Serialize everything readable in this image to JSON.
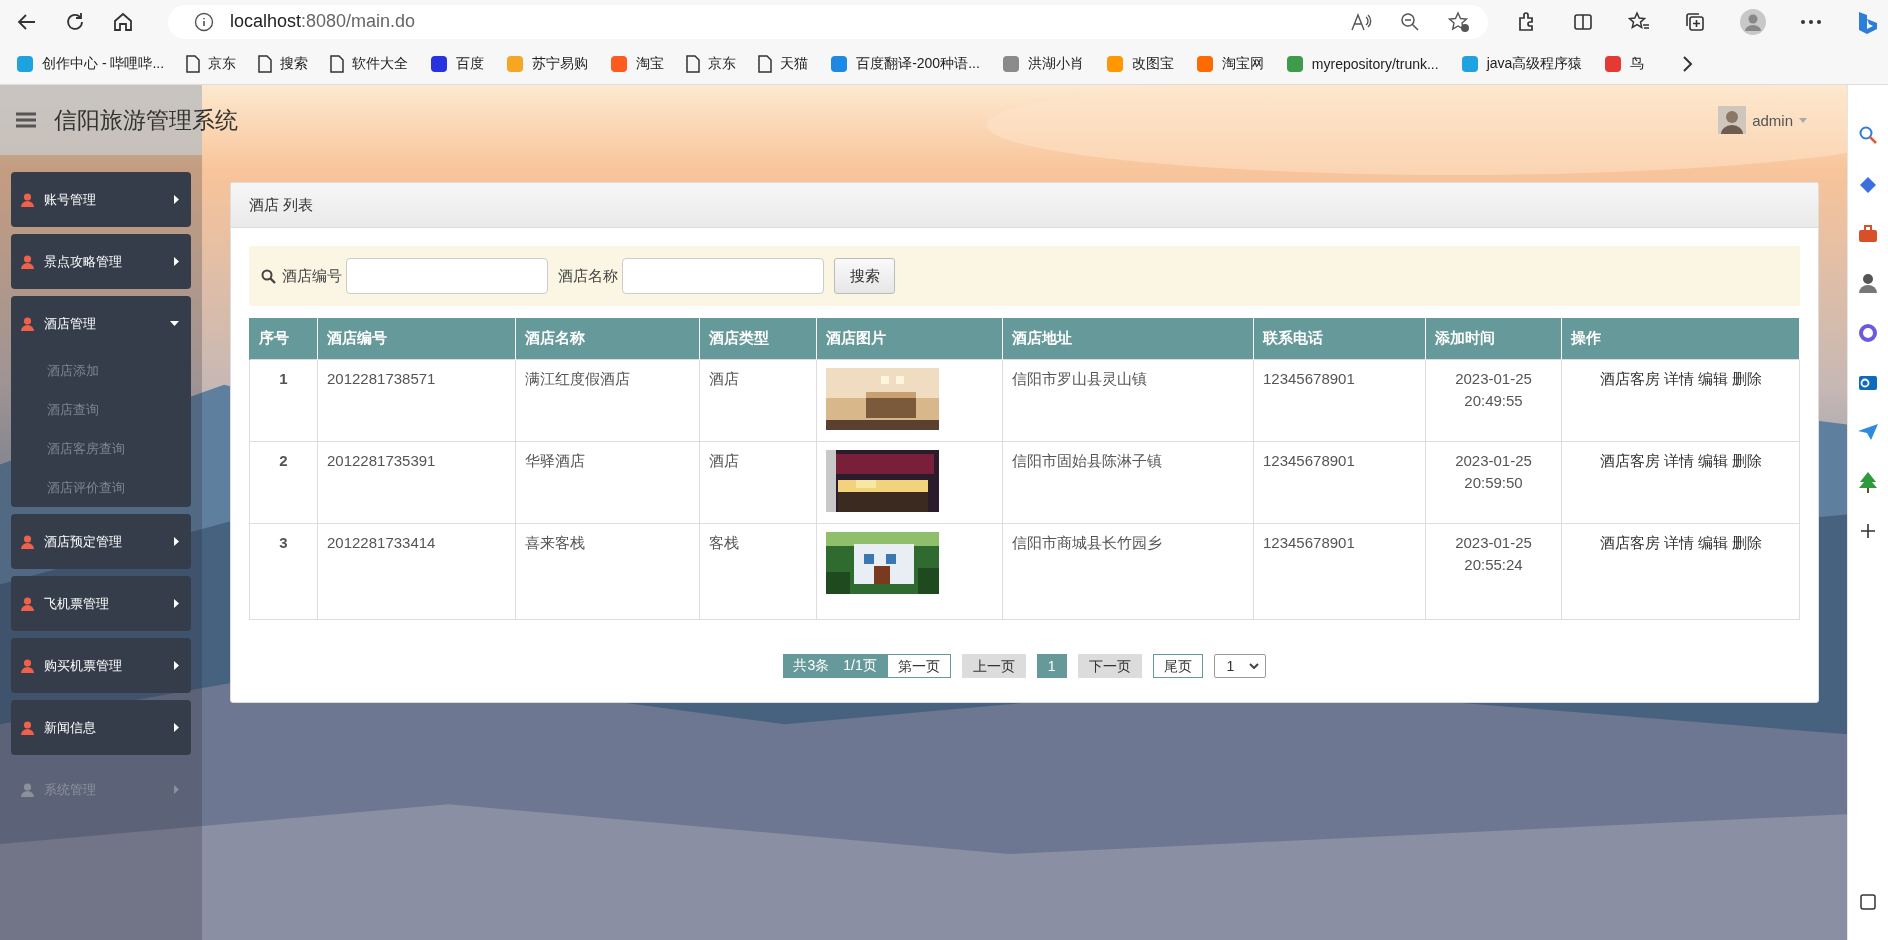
{
  "browser": {
    "address": {
      "host": "localhost",
      "path": ":8080/main.do"
    },
    "bookmarks": [
      {
        "label": "创作中心 - 哔哩哔...",
        "kind": "site",
        "color": "#1fa3e0"
      },
      {
        "label": "京东",
        "kind": "page"
      },
      {
        "label": "搜索",
        "kind": "page"
      },
      {
        "label": "软件大全",
        "kind": "page"
      },
      {
        "label": "百度",
        "kind": "site",
        "color": "#2932e1"
      },
      {
        "label": "苏宁易购",
        "kind": "site",
        "color": "#f5a623"
      },
      {
        "label": "淘宝",
        "kind": "site",
        "color": "#ff5a1f"
      },
      {
        "label": "京东",
        "kind": "page"
      },
      {
        "label": "天猫",
        "kind": "page"
      },
      {
        "label": "百度翻译-200种语...",
        "kind": "site",
        "color": "#1e88e5"
      },
      {
        "label": "洪湖小肖",
        "kind": "site",
        "color": "#8a8a8a"
      },
      {
        "label": "改图宝",
        "kind": "site",
        "color": "#ff9800"
      },
      {
        "label": "淘宝网",
        "kind": "site",
        "color": "#ff6a00"
      },
      {
        "label": "myrepository/trunk...",
        "kind": "site",
        "color": "#3f9a4a"
      },
      {
        "label": "java高级程序猿",
        "kind": "site",
        "color": "#1fa3e0"
      },
      {
        "label": "鸟",
        "kind": "site",
        "color": "#e53935"
      }
    ]
  },
  "header": {
    "title": "信阳旅游管理系统",
    "user": "admin"
  },
  "sidebar": {
    "items": [
      {
        "label": "账号管理",
        "expanded": false,
        "disabled": false
      },
      {
        "label": "景点攻略管理",
        "expanded": false,
        "disabled": false
      },
      {
        "label": "酒店管理",
        "expanded": true,
        "disabled": false,
        "children": [
          {
            "label": "酒店添加"
          },
          {
            "label": "酒店查询"
          },
          {
            "label": "酒店客房查询"
          },
          {
            "label": "酒店评价查询"
          }
        ]
      },
      {
        "label": "酒店预定管理",
        "expanded": false,
        "disabled": false
      },
      {
        "label": "飞机票管理",
        "expanded": false,
        "disabled": false
      },
      {
        "label": "购买机票管理",
        "expanded": false,
        "disabled": false
      },
      {
        "label": "新闻信息",
        "expanded": false,
        "disabled": false
      },
      {
        "label": "系统管理",
        "expanded": false,
        "disabled": true
      }
    ]
  },
  "panel": {
    "title": "酒店 列表",
    "search": {
      "fields": [
        {
          "label": "酒店编号"
        },
        {
          "label": "酒店名称"
        }
      ],
      "button": "搜索"
    },
    "table": {
      "columns": [
        "序号",
        "酒店编号",
        "酒店名称",
        "酒店类型",
        "酒店图片",
        "酒店地址",
        "联系电话",
        "添加时间",
        "操作"
      ],
      "rows": [
        {
          "no": "1",
          "code": "2012281738571",
          "name": "满江红度假酒店",
          "type": "酒店",
          "address": "信阳市罗山县灵山镇",
          "phone": "12345678901",
          "date": "2023-01-25",
          "time": "20:49:55",
          "actions": [
            "酒店客房",
            "详情",
            "编辑",
            "删除"
          ]
        },
        {
          "no": "2",
          "code": "2012281735391",
          "name": "华驿酒店",
          "type": "酒店",
          "address": "信阳市固始县陈淋子镇",
          "phone": "12345678901",
          "date": "2023-01-25",
          "time": "20:59:50",
          "actions": [
            "酒店客房",
            "详情",
            "编辑",
            "删除"
          ]
        },
        {
          "no": "3",
          "code": "2012281733414",
          "name": "喜来客栈",
          "type": "客栈",
          "address": "信阳市商城县长竹园乡",
          "phone": "12345678901",
          "date": "2023-01-25",
          "time": "20:55:24",
          "actions": [
            "酒店客房",
            "详情",
            "编辑",
            "删除"
          ]
        }
      ]
    },
    "pagination": {
      "summary": "共3条",
      "pages": "1/1页",
      "items": [
        {
          "label": "第一页",
          "kind": "nav",
          "disabled": false
        },
        {
          "label": "上一页",
          "kind": "nav",
          "disabled": true
        },
        {
          "label": "1",
          "kind": "page",
          "selected": true
        },
        {
          "label": "下一页",
          "kind": "nav",
          "disabled": true
        },
        {
          "label": "尾页",
          "kind": "nav",
          "disabled": false
        }
      ],
      "select": "1"
    }
  }
}
